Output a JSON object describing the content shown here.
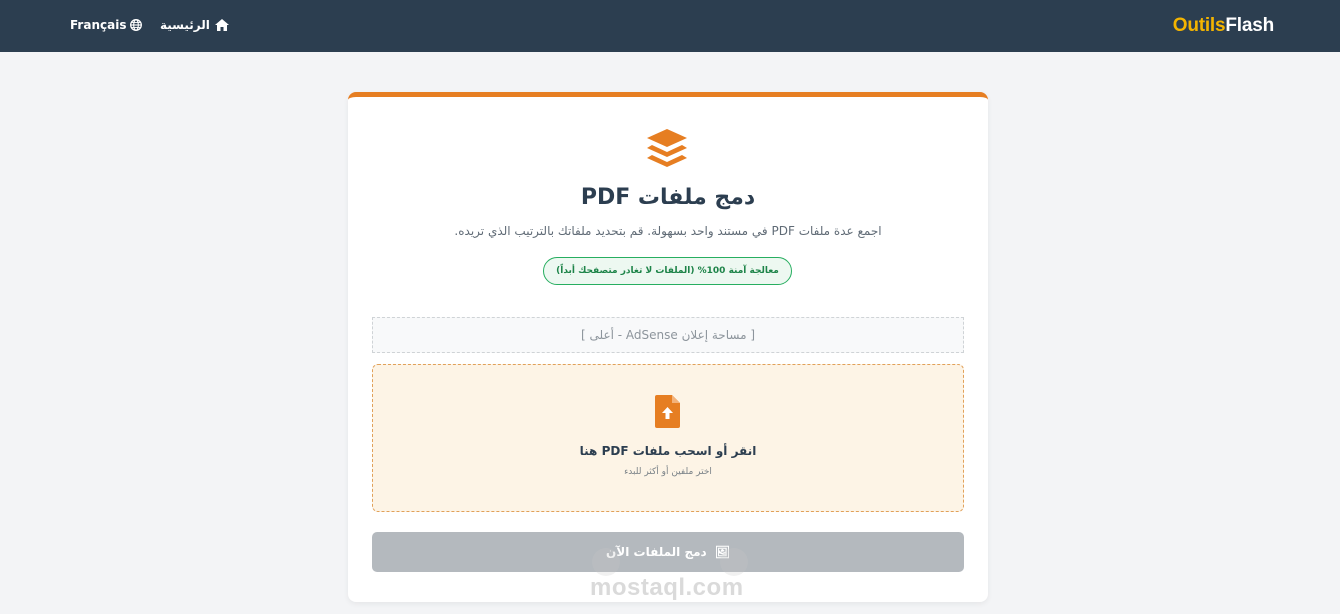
{
  "nav": {
    "logo_part1": "Outils",
    "logo_part2": "Flash",
    "home_label": "الرئيسية",
    "home_icon": "home-icon",
    "language_label": "Français",
    "language_icon": "globe-icon"
  },
  "tool": {
    "icon": "layers-icon",
    "title": "دمج ملفات PDF",
    "subtitle": "اجمع عدة ملفات PDF في مستند واحد بسهولة. قم بتحديد ملفاتك بالترتيب الذي تريده.",
    "secure_badge": "معالجة آمنة 100% (الملفات لا تغادر متصفحك أبداً)"
  },
  "ad": {
    "label": "[ مساحة إعلان AdSense - أعلى ]"
  },
  "dropzone": {
    "icon": "file-upload-icon",
    "title": "انقر أو اسحب ملفات PDF هنا",
    "hint": "اختر ملفين أو أكثر للبدء"
  },
  "merge_button": {
    "label": "دمج الملفات الآن",
    "icon": "🖼"
  },
  "watermark": {
    "text": "mostaql.com"
  },
  "colors": {
    "navbar": "#2c3e50",
    "accent": "#e67e22",
    "logo_yellow": "#f4b400",
    "success": "#27ae60",
    "button_disabled": "#b4b9be"
  }
}
